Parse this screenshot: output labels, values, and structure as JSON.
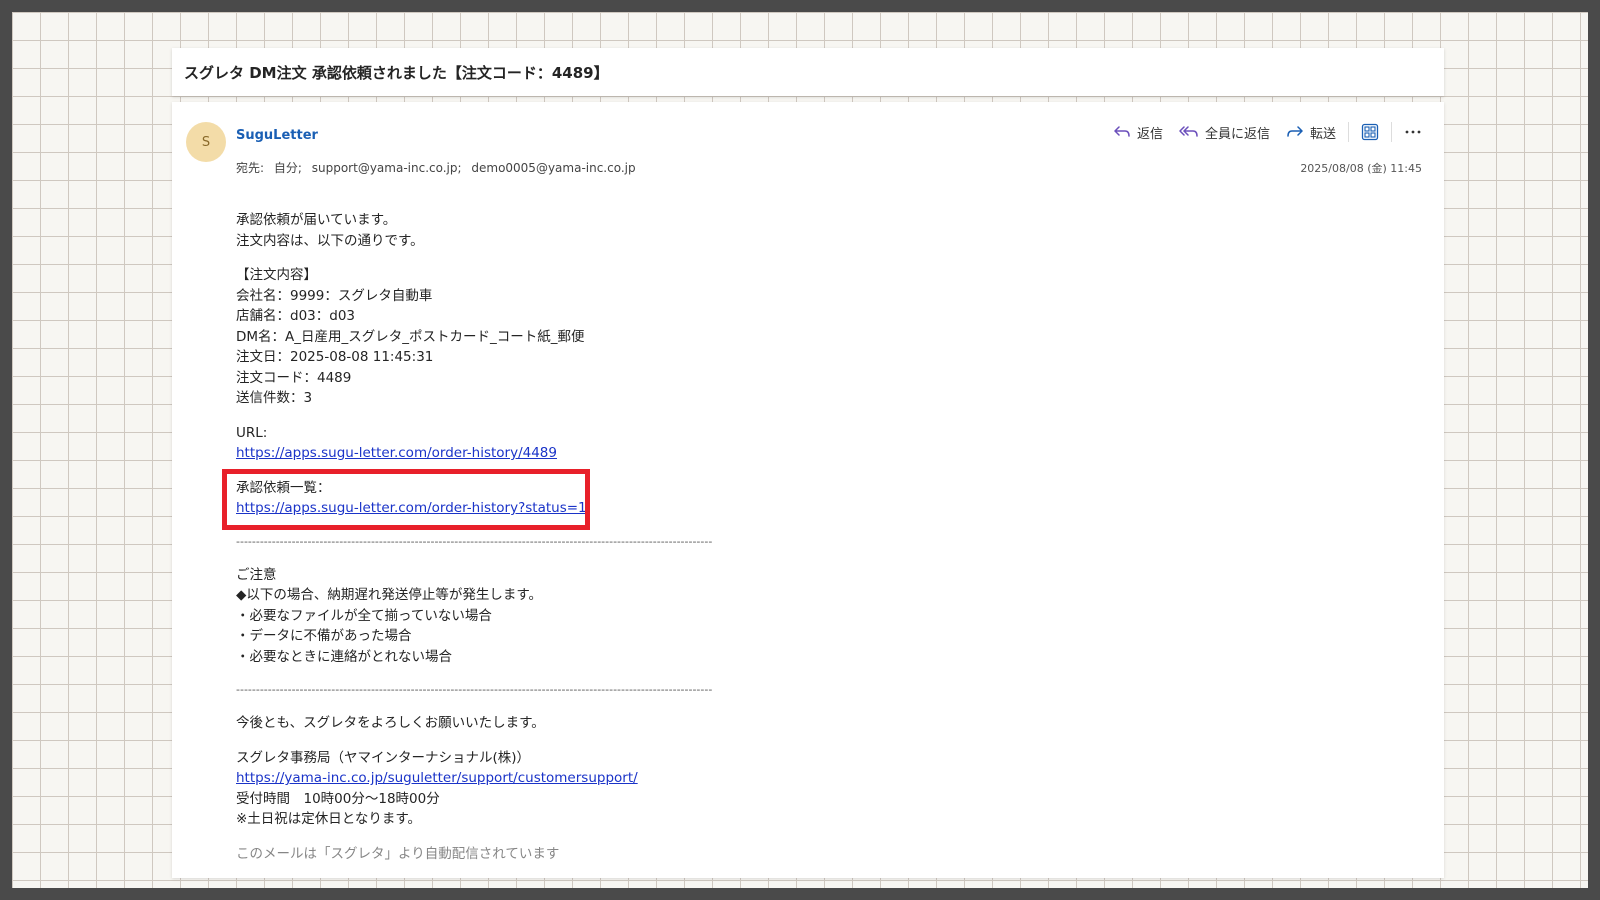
{
  "subject": "スグレタ DM注文 承認依頼されました【注文コード：4489】",
  "sender": {
    "initial": "S",
    "name": "SuguLetter"
  },
  "recipients": {
    "prefix": "宛先:",
    "self": "自分;",
    "to1": "support@yama-inc.co.jp;",
    "to2": "demo0005@yama-inc.co.jp"
  },
  "actions": {
    "reply": "返信",
    "reply_all": "全員に返信",
    "forward": "転送"
  },
  "datetime": "2025/08/08 (金) 11:45",
  "body": {
    "intro1": "承認依頼が届いています。",
    "intro2": "注文内容は、以下の通りです。",
    "section_title": "【注文内容】",
    "company": "会社名：9999：スグレタ自動車",
    "store": "店舗名：d03：d03",
    "dm_name": "DM名：A_日産用_スグレタ_ポストカード_コート紙_郵便",
    "order_date": "注文日：2025-08-08 11:45:31",
    "order_code": "注文コード：4489",
    "send_count": "送信件数：3",
    "url_label": "URL:",
    "url": "https://apps.sugu-letter.com/order-history/4489",
    "approval_list_label": "承認依頼一覧：",
    "approval_list_url": "https://apps.sugu-letter.com/order-history?status=1",
    "separator": "------------------------------------------------------------------------------------------------------------------------",
    "notice_title": "ご注意",
    "notice_lead": "◆以下の場合、納期遅れ発送停止等が発生します。",
    "notice_1": "・必要なファイルが全て揃っていない場合",
    "notice_2": "・データに不備があった場合",
    "notice_3": "・必要なときに連絡がとれない場合",
    "closing": "今後とも、スグレタをよろしくお願いいたします。",
    "office": "スグレタ事務局（ヤマインターナショナル(株)）",
    "support_url": "https://yama-inc.co.jp/suguletter/support/customersupport/",
    "hours": "受付時間　10時00分～18時00分",
    "holiday": "※土日祝は定休日となります。",
    "cutoff_line": "このメールは「スグレタ」より自動配信されています"
  },
  "colors": {
    "link": "#1a33c8",
    "sender": "#1a5fb4",
    "highlight": "#e8202a",
    "reply_icon": "#6b4fbb"
  },
  "icons": [
    "reply-icon",
    "reply-all-icon",
    "forward-icon",
    "grid-app-icon",
    "more-icon"
  ]
}
